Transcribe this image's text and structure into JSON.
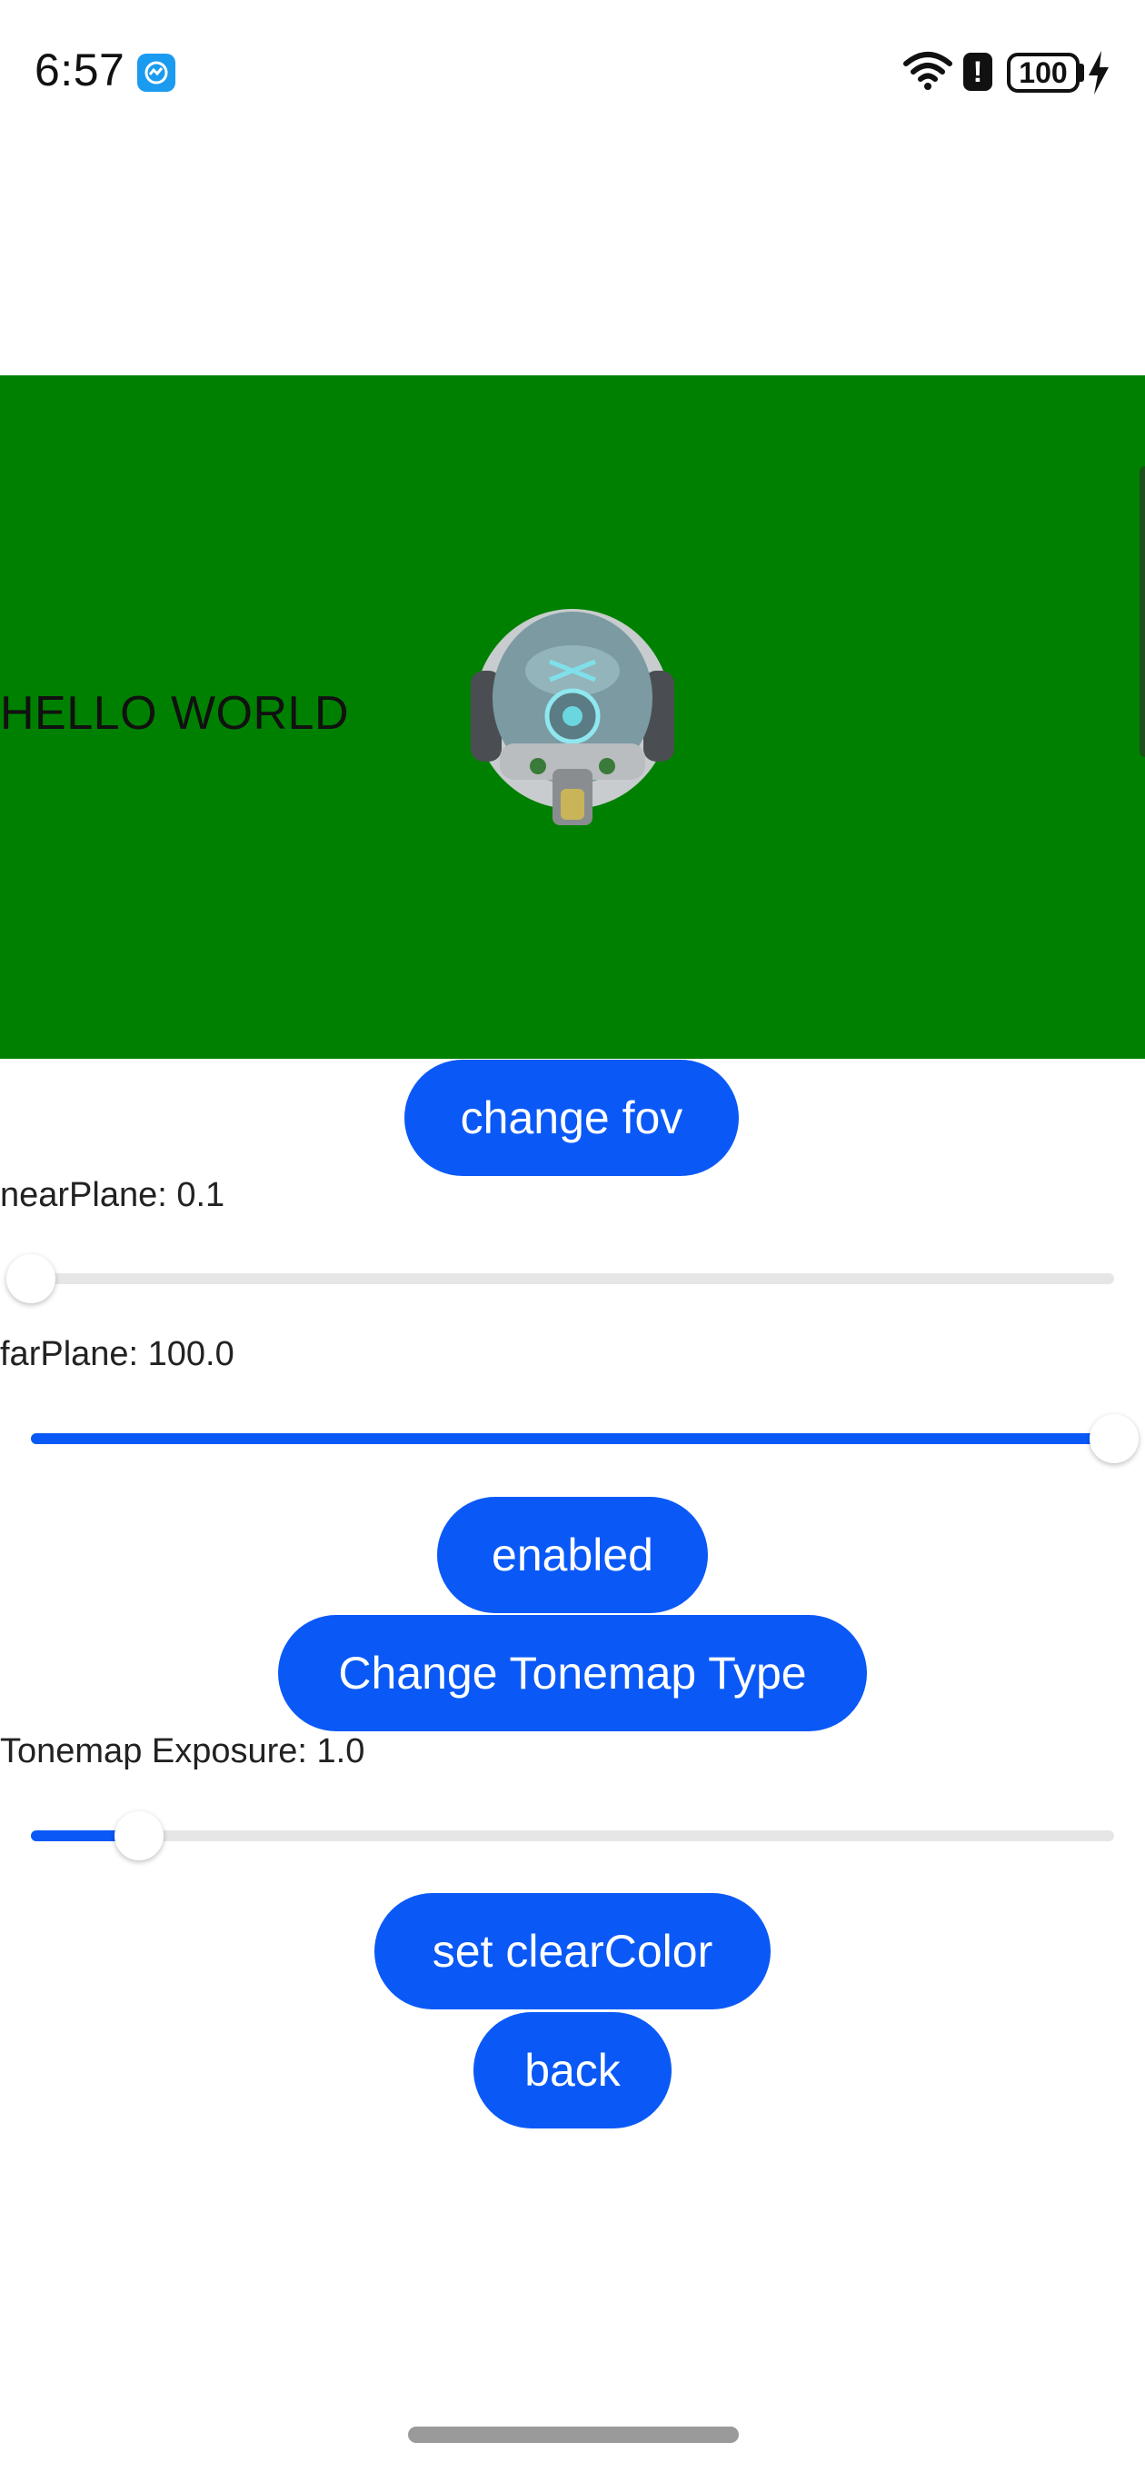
{
  "status_bar": {
    "time": "6:57",
    "battery": "100",
    "icons": [
      "app-notification-icon",
      "wifi-icon",
      "alert-icon",
      "battery-icon",
      "charging-icon"
    ]
  },
  "scene": {
    "background_color": "#008000",
    "overlay_text": "HELLO WORLD",
    "model": "helmet-model"
  },
  "controls": {
    "change_fov_label": "change fov",
    "near_plane_label": "nearPlane: 0.1",
    "near_plane_value": 0.0,
    "far_plane_label": "farPlane: 100.0",
    "far_plane_value": 1.0,
    "enabled_label": "enabled",
    "change_tonemap_label": "Change Tonemap Type",
    "tonemap_exposure_label": "Tonemap Exposure: 1.0",
    "tonemap_exposure_value": 0.1,
    "set_clear_color_label": "set clearColor",
    "back_label": "back"
  },
  "colors": {
    "accent": "#0a59f7",
    "track": "#e6e6e6"
  }
}
